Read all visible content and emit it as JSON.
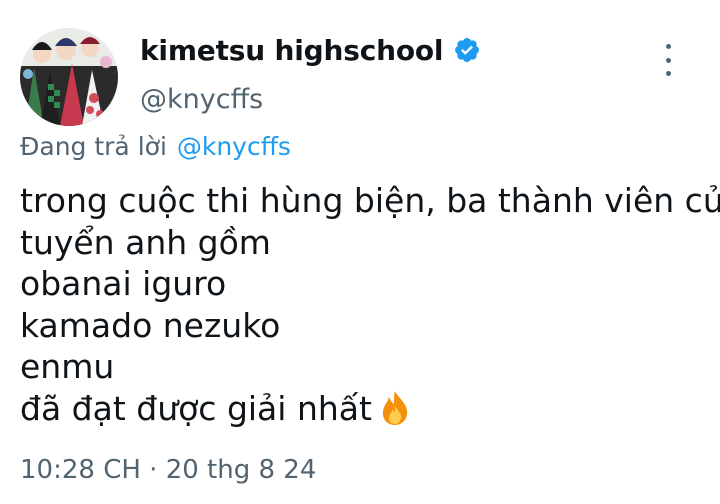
{
  "tweet": {
    "display_name": "kimetsu highschool",
    "handle": "@knycffs",
    "verified_icon": "verified-badge-icon",
    "reply_prefix": "Đang trả lời",
    "reply_to": "@knycffs",
    "lines": [
      "trong cuộc thi hùng biện, ba thành viên của",
      "tuyển anh gồm",
      "obanai iguro",
      "kamado nezuko",
      "enmu",
      "đã đạt được giải nhất"
    ],
    "emoji_icon": "fire-icon",
    "timestamp": "10:28 CH · 20 thg 8 24"
  },
  "colors": {
    "accent": "#1d9bf0",
    "secondary_text": "#536471",
    "primary_text": "#0f1419"
  }
}
